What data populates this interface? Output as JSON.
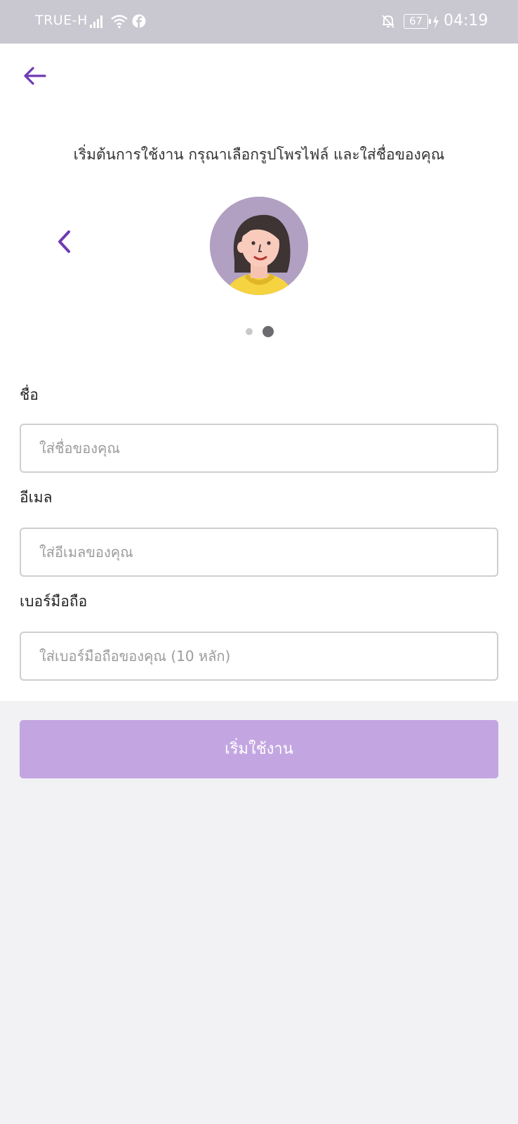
{
  "status_bar": {
    "carrier": "TRUE-H",
    "battery": "67",
    "time": "04:19"
  },
  "icons": {
    "back": "arrow-left-icon",
    "prev_avatar": "chevron-left-icon"
  },
  "colors": {
    "accent": "#6f3bb4",
    "button": "#c3a6e1",
    "status_bar": "#c9c7cf"
  },
  "heading": "เริ่มต้นการใช้งาน กรุณาเลือกรูปโพรไฟล์ และใส่ชื่อของคุณ",
  "pager": {
    "count": 2,
    "active_index": 1
  },
  "form": {
    "name_label": "ชื่อ",
    "name_placeholder": "ใส่ชื่อของคุณ",
    "email_label": "อีเมล",
    "email_placeholder": "ใส่อีเมลของคุณ",
    "phone_label": "เบอร์มือถือ",
    "phone_placeholder": "ใส่เบอร์มือถือของคุณ (10 หลัก)"
  },
  "start_button": "เริ่มใช้งาน"
}
